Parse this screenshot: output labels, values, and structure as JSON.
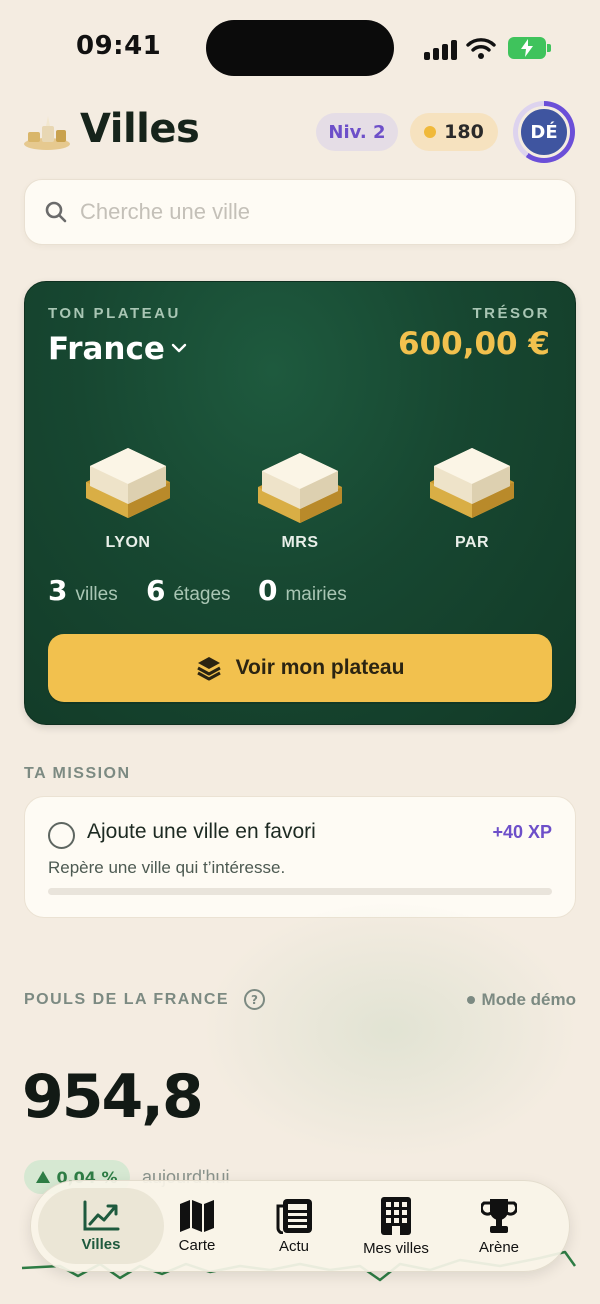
{
  "status_bar": {
    "time": "09:41"
  },
  "header": {
    "title": "Villes",
    "level": "Niv. 2",
    "coins": "180",
    "avatar_initials": "DÉ",
    "xp_progress": 0.6
  },
  "search": {
    "placeholder": "Cherche une ville"
  },
  "board": {
    "label": "TON PLATEAU",
    "country": "France",
    "treasure_label": "TRÉSOR",
    "treasure_value": "600,00 €",
    "cities": [
      {
        "code": "LYON"
      },
      {
        "code": "MRS"
      },
      {
        "code": "PAR"
      }
    ],
    "stats": [
      {
        "value": "3",
        "label": "villes"
      },
      {
        "value": "6",
        "label": "étages"
      },
      {
        "value": "0",
        "label": "mairies"
      }
    ],
    "button_label": "Voir mon plateau"
  },
  "mission": {
    "section_label": "TA MISSION",
    "title": "Ajoute une ville en favori",
    "xp": "+40 XP",
    "description": "Repère une ville qui t’intéresse.",
    "progress": 0
  },
  "pulse": {
    "section_label": "POULS DE LA FRANCE",
    "help": "?",
    "mode": "Mode démo",
    "value": "954,8",
    "change": "0,04 %",
    "period": "aujourd'hui"
  },
  "tabs": [
    {
      "label": "Villes",
      "icon": "chart-line-icon",
      "active": true
    },
    {
      "label": "Carte",
      "icon": "map-icon",
      "active": false
    },
    {
      "label": "Actu",
      "icon": "newspaper-icon",
      "active": false
    },
    {
      "label": "Mes villes",
      "icon": "building-icon",
      "active": false
    },
    {
      "label": "Arène",
      "icon": "trophy-icon",
      "active": false
    }
  ],
  "colors": {
    "background": "#f4ece1",
    "board_green": "#174731",
    "accent_yellow": "#f2c14e",
    "accent_purple": "#6d4fc9",
    "positive_green": "#2e7d45"
  }
}
